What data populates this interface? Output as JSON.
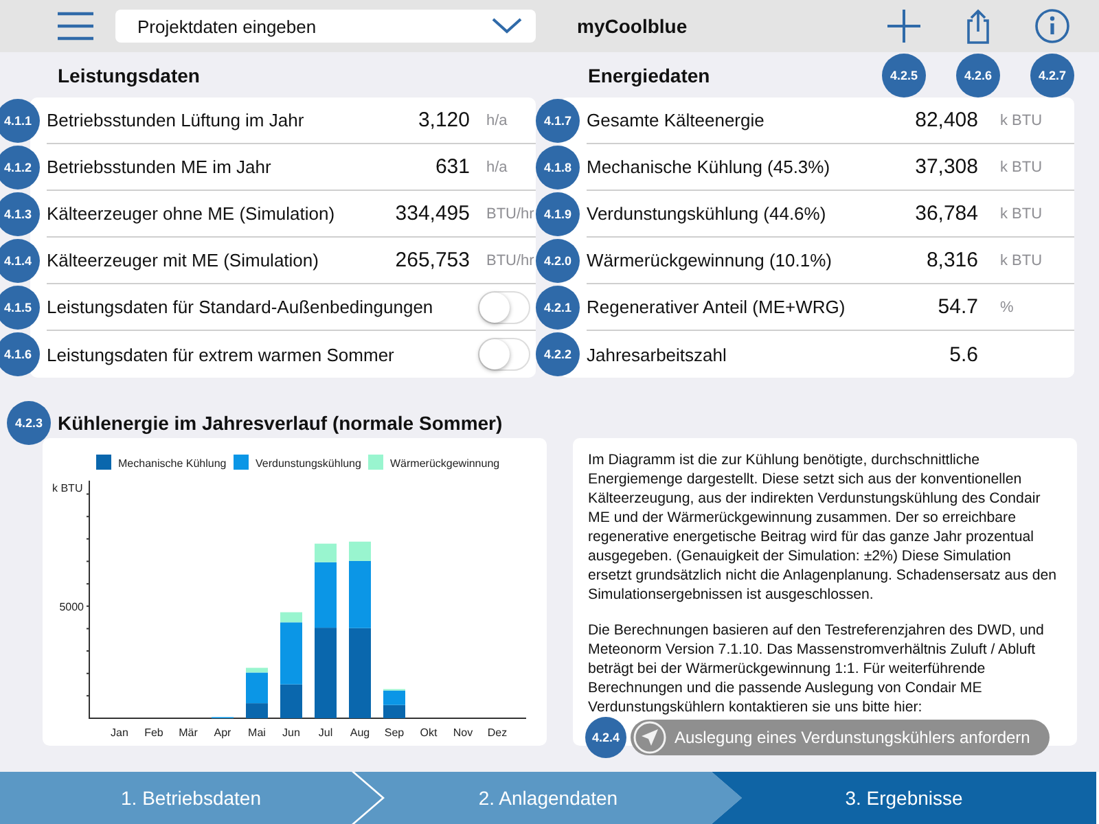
{
  "header": {
    "dropdown": {
      "value": "Projektdaten eingeben"
    },
    "app_title": "myCoolblue",
    "actions": [
      {
        "kind": "plus",
        "badge": "4.2.5"
      },
      {
        "kind": "share",
        "badge": "4.2.6"
      },
      {
        "kind": "info",
        "badge": "4.2.7"
      }
    ]
  },
  "performance": {
    "title": "Leistungsdaten",
    "rows": [
      {
        "kind": "value",
        "badge": "4.1.1",
        "label": "Betriebsstunden Lüftung im Jahr",
        "value": "3,120",
        "unit": "h/a"
      },
      {
        "kind": "value",
        "badge": "4.1.2",
        "label": "Betriebsstunden ME im Jahr",
        "value": "631",
        "unit": "h/a"
      },
      {
        "kind": "value",
        "badge": "4.1.3",
        "label": "Kälteerzeuger ohne ME (Simulation)",
        "value": "334,495",
        "unit": "BTU/hr"
      },
      {
        "kind": "value",
        "badge": "4.1.4",
        "label": "Kälteerzeuger mit ME (Simulation)",
        "value": "265,753",
        "unit": "BTU/hr"
      },
      {
        "kind": "toggle",
        "badge": "4.1.5",
        "label": "Leistungsdaten für Standard-Außenbedingungen",
        "on": false
      },
      {
        "kind": "toggle",
        "badge": "4.1.6",
        "label": "Leistungsdaten für extrem warmen Sommer",
        "on": false
      }
    ]
  },
  "energy": {
    "title": "Energiedaten",
    "rows": [
      {
        "kind": "value",
        "badge": "4.1.7",
        "label": "Gesamte Kälteenergie",
        "value": "82,408",
        "unit": "k BTU"
      },
      {
        "kind": "value",
        "badge": "4.1.8",
        "label": "Mechanische Kühlung (45.3%)",
        "value": "37,308",
        "unit": "k BTU"
      },
      {
        "kind": "value",
        "badge": "4.1.9",
        "label": "Verdunstungskühlung (44.6%)",
        "value": "36,784",
        "unit": "k BTU"
      },
      {
        "kind": "value",
        "badge": "4.2.0",
        "label": "Wärmerückgewinnung (10.1%)",
        "value": "8,316",
        "unit": "k BTU"
      },
      {
        "kind": "value",
        "badge": "4.2.1",
        "label": "Regenerativer Anteil (ME+WRG)",
        "value": "54.7",
        "unit": "%"
      },
      {
        "kind": "value",
        "badge": "4.2.2",
        "label": "Jahresarbeitszahl",
        "value": "5.6"
      }
    ]
  },
  "chart_section": {
    "badge": "4.2.3",
    "title": "Kühlenergie im Jahresverlauf (normale Sommer)",
    "chart_data": {
      "type": "bar",
      "stacked": true,
      "ylabel": "k BTU",
      "categories": [
        "Jan",
        "Feb",
        "Mär",
        "Apr",
        "Mai",
        "Jun",
        "Jul",
        "Aug",
        "Sep",
        "Okt",
        "Nov",
        "Dez"
      ],
      "series": [
        {
          "name": "Mechanische Kühlung",
          "color": "#0a67ad",
          "values": [
            0,
            0,
            0,
            0,
            670,
            1510,
            4040,
            4020,
            590,
            0,
            0,
            0
          ]
        },
        {
          "name": "Verdunstungskühlung",
          "color": "#0b96e6",
          "values": [
            0,
            0,
            0,
            50,
            1370,
            2770,
            2920,
            3000,
            650,
            0,
            0,
            0
          ]
        },
        {
          "name": "Wärmerückgewinnung",
          "color": "#99f5cf",
          "values": [
            0,
            0,
            0,
            0,
            210,
            450,
            830,
            860,
            60,
            0,
            0,
            0
          ]
        }
      ],
      "ylim": [
        0,
        10600
      ],
      "yticks": [
        5000
      ],
      "legend": true
    }
  },
  "info": {
    "paragraphs": [
      "Im Diagramm ist die zur Kühlung benötigte, durchschnittliche Energiemenge dargestellt. Diese setzt sich aus der konventionellen Kälteerzeugung, aus der indirekten Verdunstungskühlung des Condair ME und der Wärmerückgewinnung zusammen. Der so erreichbare regenerative energetische Beitrag wird für das ganze Jahr prozentual ausgegeben. (Genauigkeit der Simulation: ±2%) Diese Simulation ersetzt grundsätzlich nicht die Anlagenplanung. Schadensersatz aus den Simulationsergebnissen ist ausgeschlossen.",
      "Die Berechnungen basieren auf den Testreferenzjahren des DWD, und Meteonorm Version 7.1.10. Das Massenstromverhältnis Zuluft / Abluft beträgt bei der Wärmerückgewinnung 1:1. Für weiterführende Berechnungen und die passende Auslegung von Condair ME Verdunstungskühlern kontaktieren sie uns bitte hier:"
    ],
    "request": {
      "badge": "4.2.4",
      "label": "Auslegung eines Verdunstungskühlers anfordern",
      "disabled": true
    }
  },
  "steps": [
    {
      "label": "1. Betriebsdaten",
      "selected": false
    },
    {
      "label": "2. Anlagendaten",
      "selected": false
    },
    {
      "label": "3. Ergebnisse",
      "selected": true
    }
  ]
}
